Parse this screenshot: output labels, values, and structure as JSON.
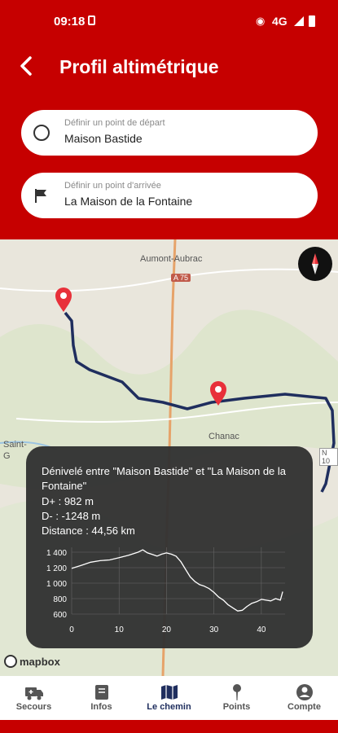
{
  "status": {
    "time": "09:18",
    "network": "4G"
  },
  "header": {
    "title": "Profil altimétrique"
  },
  "route": {
    "start": {
      "placeholder": "Définir un point de départ",
      "value": "Maison Bastide"
    },
    "end": {
      "placeholder": "Définir un point d'arrivée",
      "value": "La Maison de la Fontaine"
    }
  },
  "map": {
    "labels": {
      "town1": "Aumont-Aubrac",
      "road": "A 75",
      "town2": "Chanac",
      "town3": "Saint-",
      "town4": "G",
      "road2": "N 10"
    },
    "attribution": "mapbox"
  },
  "elevation": {
    "description": "Dénivelé entre \"Maison Bastide\" et \"La Maison de la Fontaine\"",
    "d_plus": "D+ : 982 m",
    "d_minus": "D- : -1248 m",
    "distance": "Distance : 44,56 km"
  },
  "chart_data": {
    "type": "line",
    "title": "",
    "xlabel": "",
    "ylabel": "",
    "x_ticks": [
      0,
      10,
      20,
      30,
      40
    ],
    "y_ticks": [
      "1 400",
      "1 200",
      "1 000",
      "800",
      "600"
    ],
    "xlim": [
      0,
      45
    ],
    "ylim": [
      500,
      1450
    ],
    "grid": true,
    "series": [
      {
        "x": [
          0,
          2,
          4,
          6,
          8,
          10,
          12,
          14,
          15,
          16,
          17,
          18,
          19,
          20,
          21,
          22,
          23,
          24,
          25,
          26,
          27,
          28,
          29,
          30,
          31,
          32,
          33,
          34,
          35,
          36,
          37,
          38,
          39,
          40,
          41,
          42,
          43,
          44,
          44.5
        ],
        "y": [
          1190,
          1230,
          1270,
          1290,
          1300,
          1330,
          1360,
          1400,
          1430,
          1390,
          1370,
          1350,
          1375,
          1390,
          1375,
          1350,
          1280,
          1180,
          1080,
          1020,
          980,
          960,
          930,
          880,
          820,
          780,
          720,
          680,
          640,
          650,
          700,
          740,
          760,
          790,
          780,
          770,
          800,
          780,
          890
        ]
      }
    ]
  },
  "nav": [
    {
      "label": "Secours",
      "icon": "ambulance-icon"
    },
    {
      "label": "Infos",
      "icon": "book-icon"
    },
    {
      "label": "Le chemin",
      "icon": "map-icon"
    },
    {
      "label": "Points",
      "icon": "pin-icon"
    },
    {
      "label": "Compte",
      "icon": "account-icon"
    }
  ],
  "colors": {
    "brand": "#c60000",
    "route": "#1f2e5e",
    "active": "#1f2e5e"
  }
}
